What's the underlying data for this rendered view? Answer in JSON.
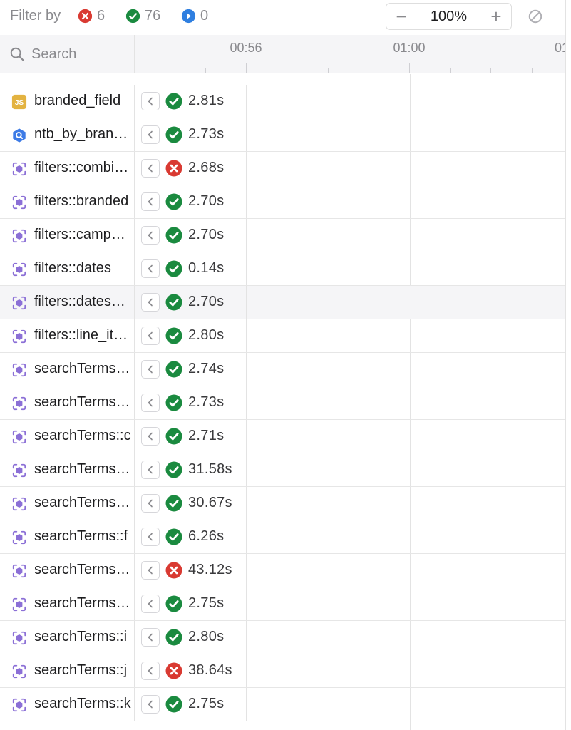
{
  "filters": {
    "label": "Filter by",
    "failed_count": "6",
    "passed_count": "76",
    "running_count": "0"
  },
  "zoom": {
    "minus": "−",
    "value": "100%",
    "plus": "+"
  },
  "search": {
    "placeholder": "Search"
  },
  "timeline": {
    "ticks": [
      "00:56",
      "01:00",
      "01"
    ]
  },
  "colors": {
    "passed": "#1a8a3f",
    "failed": "#d93a32",
    "running": "#2f7fe0",
    "js_icon": "#e3b341",
    "query_icon": "#3d7be6",
    "test_icon": "#8b6fd6"
  },
  "rows": [
    {
      "icon": "js-icon",
      "name": "branded_field",
      "status": "passed",
      "duration": "2.81s"
    },
    {
      "icon": "query-icon",
      "name": "ntb_by_brand_type",
      "status": "passed",
      "duration": "2.73s"
    },
    {
      "icon": "test-icon",
      "name": "filters::combined",
      "status": "failed",
      "duration": "2.68s"
    },
    {
      "icon": "test-icon",
      "name": "filters::branded",
      "status": "passed",
      "duration": "2.70s"
    },
    {
      "icon": "test-icon",
      "name": "filters::campaign",
      "status": "passed",
      "duration": "2.70s"
    },
    {
      "icon": "test-icon",
      "name": "filters::dates",
      "status": "passed",
      "duration": "0.14s"
    },
    {
      "icon": "test-icon",
      "name": "filters::dates_range",
      "status": "passed",
      "duration": "2.70s",
      "hover": true
    },
    {
      "icon": "test-icon",
      "name": "filters::line_item",
      "status": "passed",
      "duration": "2.80s"
    },
    {
      "icon": "test-icon",
      "name": "searchTerms::a",
      "status": "passed",
      "duration": "2.74s"
    },
    {
      "icon": "test-icon",
      "name": "searchTerms::b",
      "status": "passed",
      "duration": "2.73s"
    },
    {
      "icon": "test-icon",
      "name": "searchTerms::c",
      "status": "passed",
      "duration": "2.71s"
    },
    {
      "icon": "test-icon",
      "name": "searchTerms::d",
      "status": "passed",
      "duration": "31.58s"
    },
    {
      "icon": "test-icon",
      "name": "searchTerms::e",
      "status": "passed",
      "duration": "30.67s"
    },
    {
      "icon": "test-icon",
      "name": "searchTerms::f",
      "status": "passed",
      "duration": "6.26s"
    },
    {
      "icon": "test-icon",
      "name": "searchTerms::g",
      "status": "failed",
      "duration": "43.12s"
    },
    {
      "icon": "test-icon",
      "name": "searchTerms::h",
      "status": "passed",
      "duration": "2.75s"
    },
    {
      "icon": "test-icon",
      "name": "searchTerms::i",
      "status": "passed",
      "duration": "2.80s"
    },
    {
      "icon": "test-icon",
      "name": "searchTerms::j",
      "status": "failed",
      "duration": "38.64s"
    },
    {
      "icon": "test-icon",
      "name": "searchTerms::k",
      "status": "passed",
      "duration": "2.75s"
    }
  ]
}
